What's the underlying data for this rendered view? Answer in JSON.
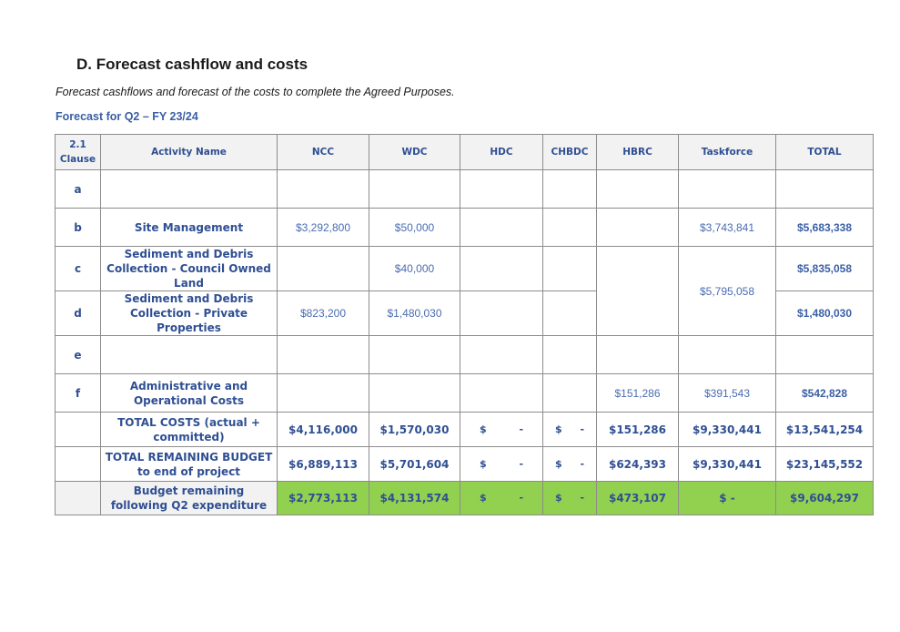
{
  "heading": "D. Forecast cashflow and costs",
  "subtitle": "Forecast cashflows and forecast of the costs to complete the Agreed Purposes.",
  "forecast_title": "Forecast for Q2 – FY 23/24",
  "table": {
    "headers": {
      "clause": "2.1 Clause",
      "activity": "Activity Name",
      "ncc": "NCC",
      "wdc": "WDC",
      "hdc": "HDC",
      "chbdc": "CHBDC",
      "hbrc": "HBRC",
      "taskforce": "Taskforce",
      "total": "TOTAL"
    },
    "rows": {
      "a": {
        "clause": "a",
        "activity": "",
        "ncc": "",
        "wdc": "",
        "hdc": "",
        "chbdc": "",
        "hbrc": "",
        "taskforce": "",
        "total": ""
      },
      "b": {
        "clause": "b",
        "activity": "Site Management",
        "ncc": "$3,292,800",
        "wdc": "$50,000",
        "hdc": "",
        "chbdc": "",
        "hbrc": "",
        "taskforce": "$3,743,841",
        "total": "$5,683,338"
      },
      "c": {
        "clause": "c",
        "activity": "Sediment and Debris Collection - Council Owned Land",
        "ncc": "",
        "wdc": "$40,000",
        "hdc": "",
        "chbdc": "",
        "total": "$5,835,058"
      },
      "d": {
        "clause": "d",
        "activity": "Sediment and Debris Collection - Private Properties",
        "ncc": "$823,200",
        "wdc": "$1,480,030",
        "hdc": "",
        "chbdc": "",
        "total": "$1,480,030"
      },
      "cd_merged": {
        "hbrc": "",
        "taskforce": "$5,795,058"
      },
      "e": {
        "clause": "e",
        "activity": "",
        "ncc": "",
        "wdc": "",
        "hdc": "",
        "chbdc": "",
        "hbrc": "",
        "taskforce": "",
        "total": ""
      },
      "f": {
        "clause": "f",
        "activity": "Administrative and Operational Costs",
        "ncc": "",
        "wdc": "",
        "hdc": "",
        "chbdc": "",
        "hbrc": "$151,286",
        "taskforce": "$391,543",
        "total": "$542,828"
      }
    },
    "totals": {
      "total_costs": {
        "label": "TOTAL COSTS (actual + committed)",
        "ncc": "$4,116,000",
        "wdc": "$1,570,030",
        "hdc_sym": "$",
        "hdc_val": "-",
        "chbdc_sym": "$",
        "chbdc_val": "-",
        "hbrc": "$151,286",
        "taskforce": "$9,330,441",
        "total": "$13,541,254"
      },
      "remaining": {
        "label": "TOTAL REMAINING BUDGET to end of project",
        "ncc": "$6,889,113",
        "wdc": "$5,701,604",
        "hdc_sym": "$",
        "hdc_val": "-",
        "chbdc_sym": "$",
        "chbdc_val": "-",
        "hbrc": "$624,393",
        "taskforce": "$9,330,441",
        "total": "$23,145,552"
      },
      "after_q2": {
        "label": "Budget remaining following Q2 expenditure",
        "ncc": "$2,773,113",
        "wdc": "$4,131,574",
        "hdc_sym": "$",
        "hdc_val": "-",
        "chbdc_sym": "$",
        "chbdc_val": "-",
        "hbrc": "$473,107",
        "taskforce": "$ -",
        "total": "$9,604,297"
      }
    },
    "highlight_color": "#92d050",
    "text_color": "#2f4f93"
  }
}
